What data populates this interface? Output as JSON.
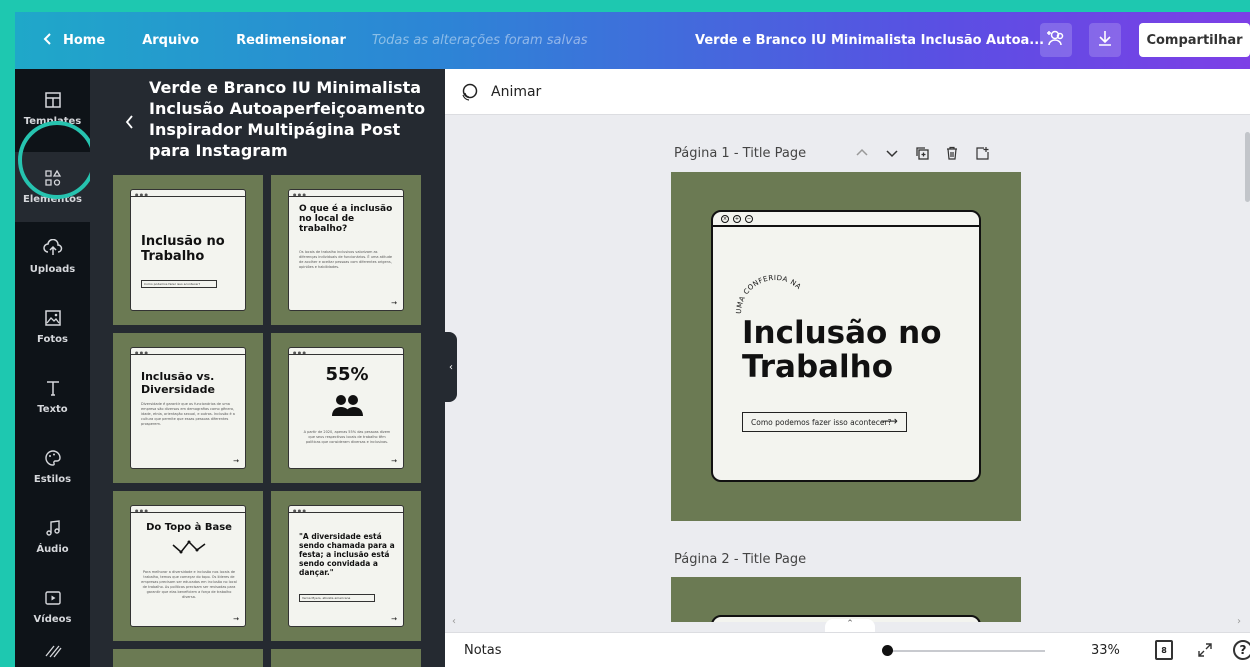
{
  "topbar": {
    "home_label": "Home",
    "file_label": "Arquivo",
    "resize_label": "Redimensionar",
    "saved_status": "Todas as alterações foram salvas",
    "doc_title": "Verde e Branco IU Minimalista Inclusão Autoa...",
    "share_label": "Compartilhar"
  },
  "rail": {
    "items": [
      {
        "label": "Templates",
        "icon": "templates-icon"
      },
      {
        "label": "Elementos",
        "icon": "elements-icon"
      },
      {
        "label": "Uploads",
        "icon": "upload-cloud-icon"
      },
      {
        "label": "Fotos",
        "icon": "photo-icon"
      },
      {
        "label": "Texto",
        "icon": "text-icon"
      },
      {
        "label": "Estilos",
        "icon": "palette-icon"
      },
      {
        "label": "Áudio",
        "icon": "music-note-icon"
      },
      {
        "label": "Vídeos",
        "icon": "video-icon"
      }
    ]
  },
  "panel": {
    "title": "Verde e Branco IU Minimalista Inclusão Autoaperfeiçoamento Inspirador Multipágina Post para Instagram",
    "thumbs": [
      {
        "title": "Inclusão no Trabalho",
        "arc": "UMA CONFERIDA NA",
        "cta": "Como podemos fazer isso acontecer?"
      },
      {
        "title": "O que é a inclusão no local de trabalho?",
        "body": "Os locais de trabalho inclusivos valorizam as diferenças individuais de funcionários. É uma atitude de acolher e aceitar pessoas com diferentes origens, opiniões e habilidades."
      },
      {
        "title": "Inclusão vs. Diversidade",
        "body": "Diversidade é garantir que os funcionários de uma empresa são diversos em demografias como gênero, idade, etnia, orientação sexual, e outros. Inclusão é a cultura que permite que essas pessoas diferentes prosperem."
      },
      {
        "title": "55%",
        "body": "A partir de 2020, apenas 55% das pessoas dizem que seus respectivos locais de trabalho têm políticas que consideram diversas e inclusivas."
      },
      {
        "title": "Do Topo à Base",
        "body": "Para melhorar a diversidade e inclusão nos locais de trabalho, temos que começar do topo. Os líderes de empresas precisam ser educados em inclusão no local de trabalho. As políticas precisam ser revisadas para garantir que elas beneficiem a força de trabalho diversa."
      },
      {
        "title": "\"A diversidade está sendo chamada para a festa; a inclusão está sendo convidada a dançar.\"",
        "cta": "Verna Myers, ativista americana"
      }
    ]
  },
  "animate": {
    "label": "Animar"
  },
  "canvas": {
    "page1_label": "Página 1 - Title Page",
    "page2_label": "Página 2 - Title Page",
    "design": {
      "arc_text": "UMA CONFERIDA NA",
      "title_line1": "Inclusão no",
      "title_line2": "Trabalho",
      "cta": "Como podemos fazer isso acontecer?"
    }
  },
  "bottom": {
    "notes_label": "Notas",
    "zoom": "33%",
    "zoom_fraction": 0.02,
    "pages_count": "8"
  }
}
